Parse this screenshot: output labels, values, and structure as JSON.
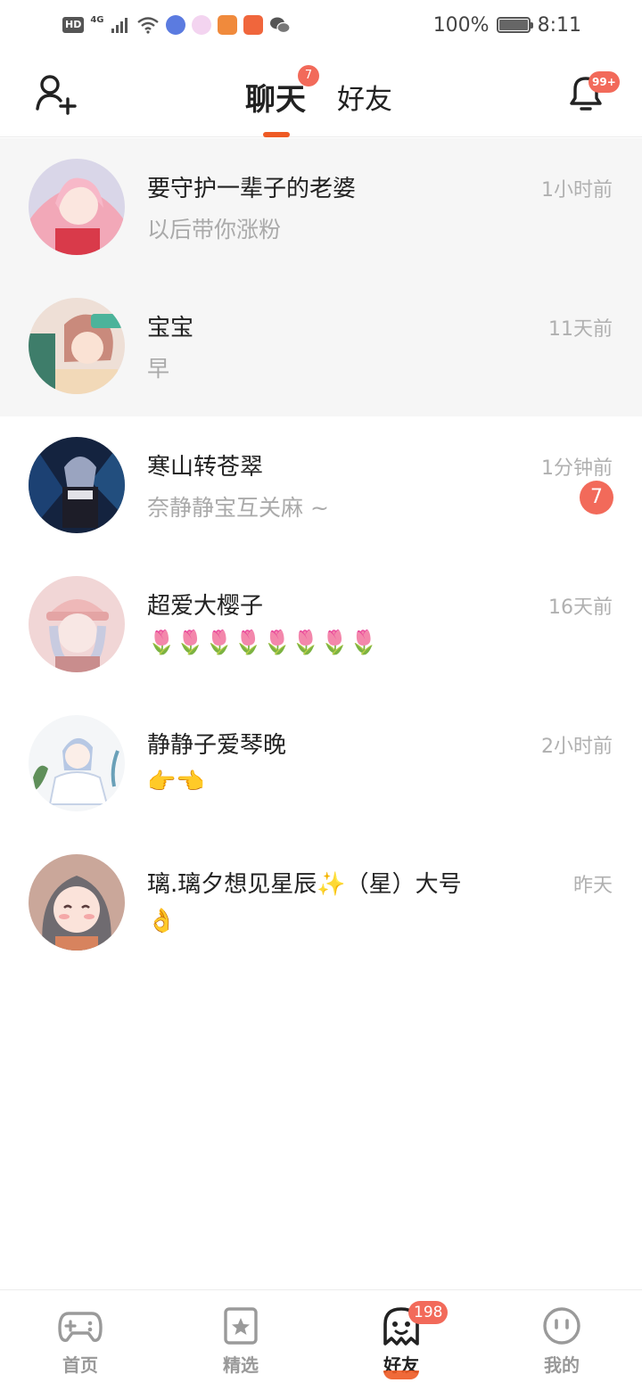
{
  "status_bar": {
    "hd_label": "HD",
    "network_label": "4G",
    "battery_percent": "100%",
    "time": "8:11"
  },
  "header": {
    "tabs": [
      {
        "label": "聊天",
        "active": true,
        "badge": "7"
      },
      {
        "label": "好友",
        "active": false
      }
    ],
    "notification_badge": "99+"
  },
  "chats": [
    {
      "name": "要守护一辈子的老婆",
      "message": "以后带你涨粉",
      "time": "1小时前",
      "pinned": true
    },
    {
      "name": "宝宝",
      "message": "早",
      "time": "11天前",
      "pinned": true
    },
    {
      "name": "寒山转苍翠",
      "message": "奈静静宝互关麻 ~",
      "time": "1分钟前",
      "unread": "7"
    },
    {
      "name": "超爱大樱子",
      "message": "🌷🌷🌷🌷🌷🌷🌷🌷",
      "time": "16天前"
    },
    {
      "name": "静静子爱琴晚",
      "message": "👉👈",
      "time": "2小时前"
    },
    {
      "name": "璃.璃夕想见星辰✨（星）大号",
      "message": "👌",
      "time": "昨天"
    }
  ],
  "bottom_nav": [
    {
      "label": "首页",
      "icon": "gamepad-icon"
    },
    {
      "label": "精选",
      "icon": "star-card-icon"
    },
    {
      "label": "好友",
      "icon": "ghost-icon",
      "active": true,
      "badge": "198"
    },
    {
      "label": "我的",
      "icon": "face-icon"
    }
  ],
  "colors": {
    "accent": "#ee5a24",
    "badge": "#f26a5a",
    "muted_text": "#aaaaaa",
    "pinned_bg": "#f6f6f6"
  }
}
